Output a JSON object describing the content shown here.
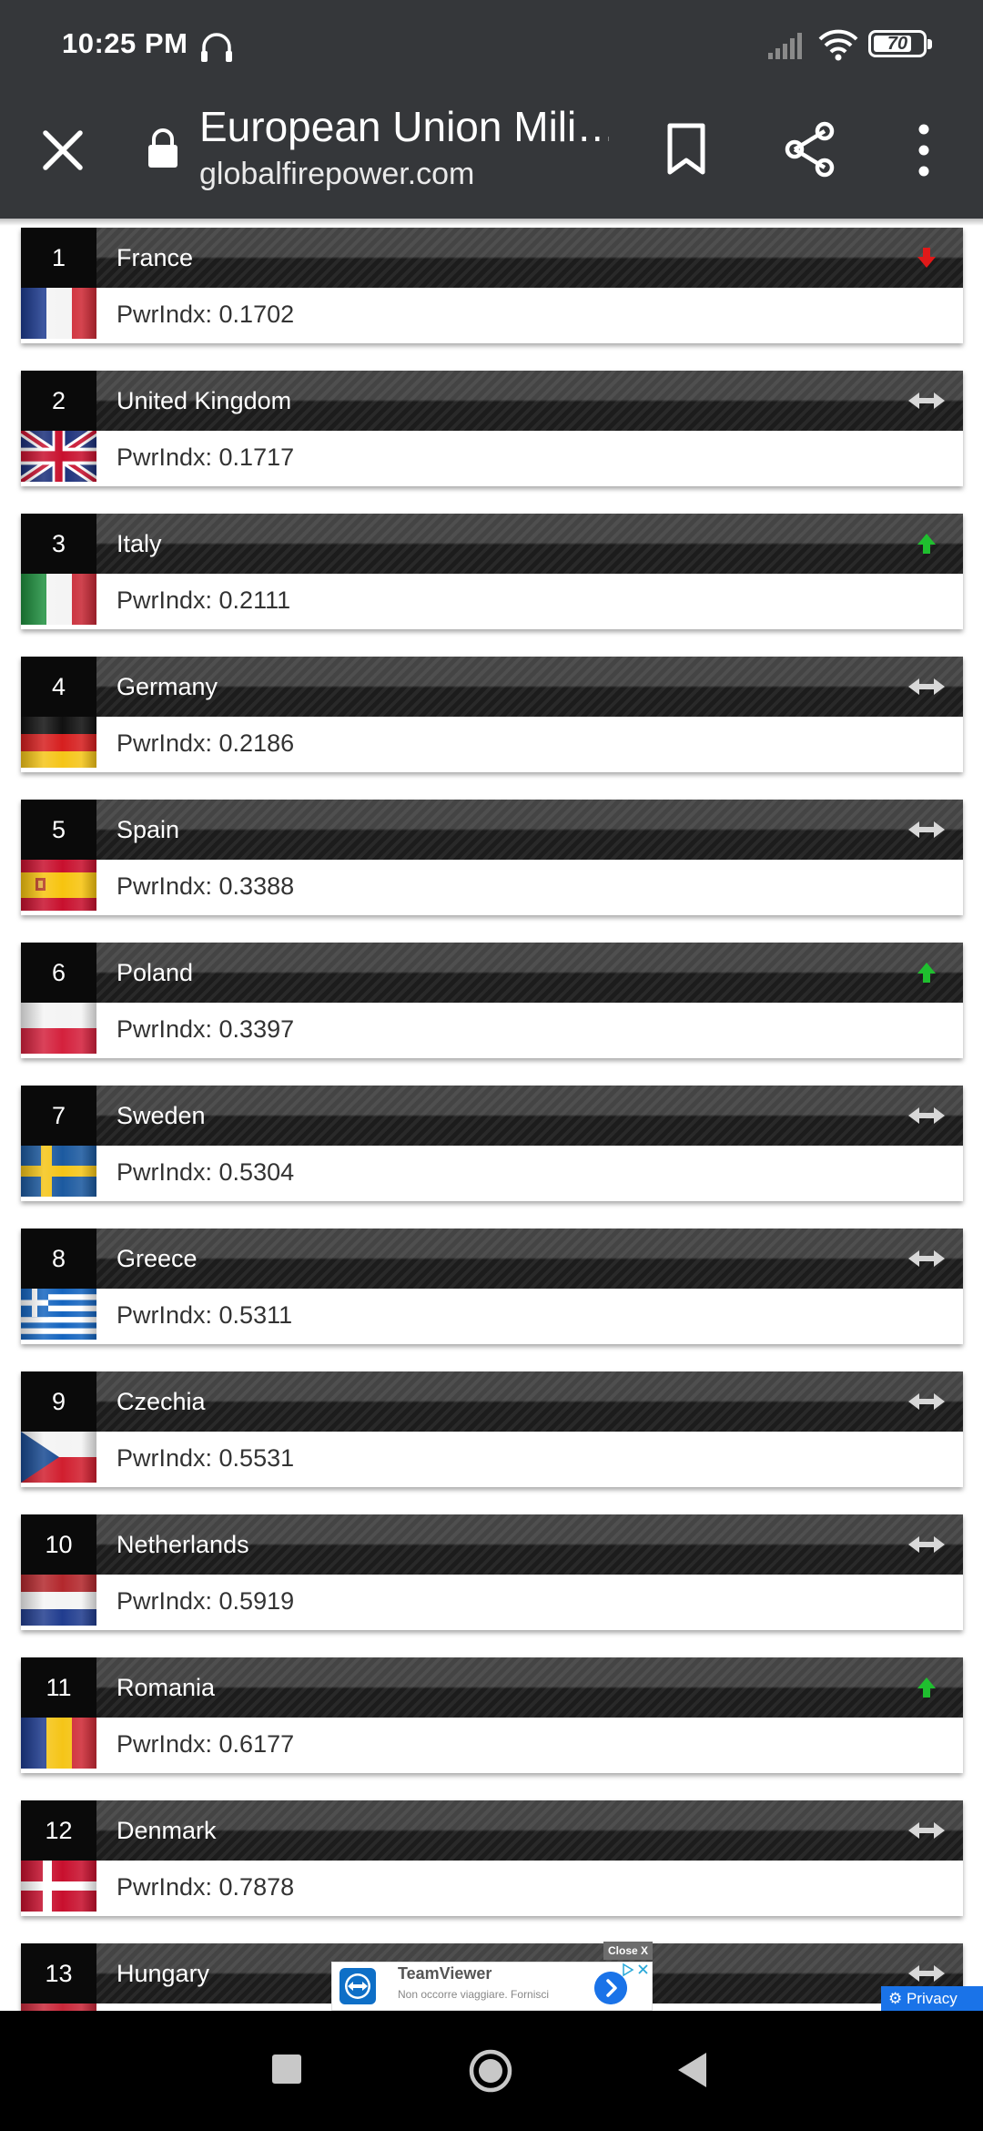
{
  "status_bar": {
    "time": "10:25 PM",
    "battery": "70",
    "icons": [
      "headphone-icon",
      "signal-icon",
      "wifi-icon",
      "battery-icon"
    ]
  },
  "toolbar": {
    "title": "European Union Mili…",
    "domain": "globalfirepower.com",
    "icons": [
      "close-icon",
      "lock-icon",
      "bookmark-icon",
      "share-icon",
      "more-vert-icon"
    ]
  },
  "colors": {
    "bar_background": "#35373a",
    "trend_up": "#1fbf2f",
    "trend_down": "#e01919",
    "trend_neutral": "#d8d8d8"
  },
  "rankings": [
    {
      "rank": "1",
      "country": "France",
      "pwr": "PwrIndx: 0.1702",
      "trend": "down",
      "flag": "france"
    },
    {
      "rank": "2",
      "country": "United Kingdom",
      "pwr": "PwrIndx: 0.1717",
      "trend": "neutral",
      "flag": "uk"
    },
    {
      "rank": "3",
      "country": "Italy",
      "pwr": "PwrIndx: 0.2111",
      "trend": "up",
      "flag": "italy"
    },
    {
      "rank": "4",
      "country": "Germany",
      "pwr": "PwrIndx: 0.2186",
      "trend": "neutral",
      "flag": "germany"
    },
    {
      "rank": "5",
      "country": "Spain",
      "pwr": "PwrIndx: 0.3388",
      "trend": "neutral",
      "flag": "spain"
    },
    {
      "rank": "6",
      "country": "Poland",
      "pwr": "PwrIndx: 0.3397",
      "trend": "up",
      "flag": "poland"
    },
    {
      "rank": "7",
      "country": "Sweden",
      "pwr": "PwrIndx: 0.5304",
      "trend": "neutral",
      "flag": "sweden"
    },
    {
      "rank": "8",
      "country": "Greece",
      "pwr": "PwrIndx: 0.5311",
      "trend": "neutral",
      "flag": "greece"
    },
    {
      "rank": "9",
      "country": "Czechia",
      "pwr": "PwrIndx: 0.5531",
      "trend": "neutral",
      "flag": "czechia"
    },
    {
      "rank": "10",
      "country": "Netherlands",
      "pwr": "PwrIndx: 0.5919",
      "trend": "neutral",
      "flag": "netherlands"
    },
    {
      "rank": "11",
      "country": "Romania",
      "pwr": "PwrIndx: 0.6177",
      "trend": "up",
      "flag": "romania"
    },
    {
      "rank": "12",
      "country": "Denmark",
      "pwr": "PwrIndx: 0.7878",
      "trend": "neutral",
      "flag": "denmark"
    },
    {
      "rank": "13",
      "country": "Hungary",
      "pwr": "",
      "trend": "neutral",
      "flag": "hungary"
    }
  ],
  "ad": {
    "close_label": "Close X",
    "title": "TeamViewer",
    "text": "Non occorre viaggiare. Fornisci",
    "privacy_label": "Privacy"
  },
  "nav_bar": {
    "icons": [
      "recents-icon",
      "home-icon",
      "back-icon"
    ]
  }
}
